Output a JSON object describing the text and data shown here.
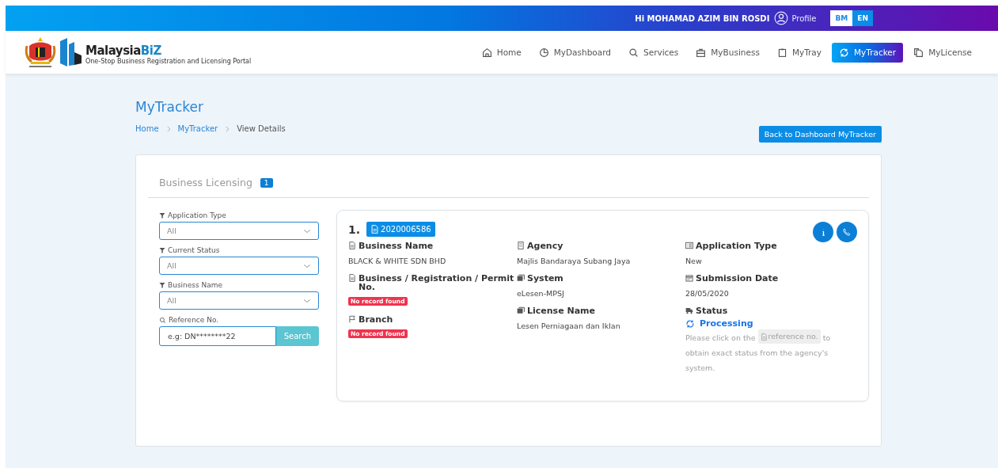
{
  "top_bar": {
    "greeting": "Hi MOHAMAD AZIM BIN ROSDI",
    "profile": "Profile",
    "languages": [
      {
        "label": "BM",
        "selected": true
      },
      {
        "label": "EN",
        "selected": false
      }
    ]
  },
  "logo": {
    "name": "Malaysia",
    "name_accent": "BiZ",
    "tagline": "One-Stop Business Registration and Licensing Portal"
  },
  "nav": [
    {
      "label": "Home",
      "selected": false
    },
    {
      "label": "MyDashboard",
      "selected": false
    },
    {
      "label": "Services",
      "selected": false
    },
    {
      "label": "MyBusiness",
      "selected": false
    },
    {
      "label": "MyTray",
      "selected": false
    },
    {
      "label": "MyTracker",
      "selected": true
    },
    {
      "label": "MyLicense",
      "selected": false
    }
  ],
  "page": {
    "title": "MyTracker",
    "breadcrumb": [
      "Home",
      "MyTracker",
      "View Details"
    ],
    "back_button": "Back to Dashboard MyTracker"
  },
  "section": {
    "title": "Business Licensing",
    "count": "1"
  },
  "filters": [
    {
      "kind": "select",
      "label": "Application Type",
      "value": "All"
    },
    {
      "kind": "select",
      "label": "Current Status",
      "value": "All"
    },
    {
      "kind": "select",
      "label": "Business Name",
      "value": "All"
    },
    {
      "kind": "search",
      "label": "Reference No.",
      "placeholder": "e.g: DN********22",
      "button": "Search"
    }
  ],
  "record": {
    "index": "1.",
    "reference": "2020006586",
    "columns": [
      [
        {
          "kind": "text",
          "label": "Business Name",
          "value": "BLACK & WHITE SDN BHD"
        },
        {
          "kind": "badge",
          "label": "Business / Registration / Permit No.",
          "value": "No record found"
        },
        {
          "kind": "badge",
          "label": "Branch",
          "value": "No record found"
        }
      ],
      [
        {
          "kind": "text",
          "label": "Agency",
          "value": "Majlis Bandaraya Subang Jaya"
        },
        {
          "kind": "text",
          "label": "System",
          "value": "eLesen-MPSJ"
        },
        {
          "kind": "text",
          "label": "License Name",
          "value": "Lesen Perniagaan dan Iklan"
        }
      ],
      [
        {
          "kind": "text",
          "label": "Application Type",
          "value": "New"
        },
        {
          "kind": "text",
          "label": "Submission Date",
          "value": "28/05/2020"
        },
        {
          "kind": "status",
          "label": "Status",
          "value": "Processing",
          "note_before": "Please click on the",
          "note_chip": "reference no.",
          "note_after": "to obtain exact status from the agency's system."
        }
      ]
    ]
  }
}
